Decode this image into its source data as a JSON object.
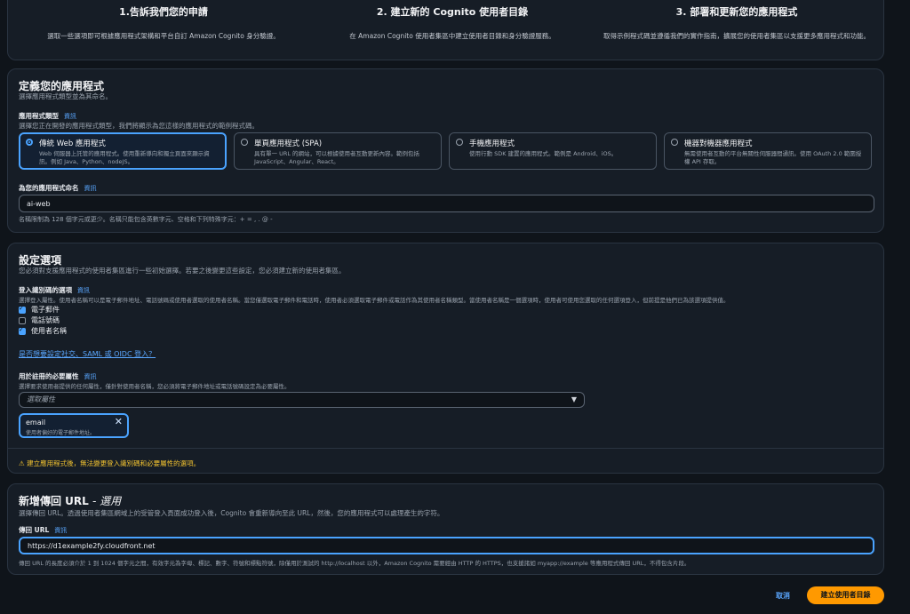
{
  "steps": [
    {
      "title": "1.告訴我們您的申請",
      "desc": "選取一些選項即可根據應用程式架構和平台自訂 Amazon Cognito 身分驗證。"
    },
    {
      "title": "2. 建立新的 Cognito 使用者目錄",
      "desc": "在 Amazon Cognito 使用者集區中建立使用者目錄和身分驗證服務。"
    },
    {
      "title": "3. 部署和更新您的應用程式",
      "desc": "取得示例程式碼並遵循我們的實作指南，擴展您的使用者集區以支援更多應用程式和功能。"
    }
  ],
  "define_app": {
    "title": "定義您的應用程式",
    "subtitle": "選擇應用程式類型並為其命名。",
    "type_label": "應用程式類型",
    "type_hint": "選擇您正在開發的應用程式類型，我們將顯示為您這樣的應用程式的範例程式碼。",
    "types": [
      {
        "title": "傳統 Web 應用程式",
        "desc": "Web 伺服器上託管的應用程式。使用重新導向和獨立頁面來顯示資訊。例如 Java、Python、nodeJS。"
      },
      {
        "title": "單頁應用程式 (SPA)",
        "desc": "具有單一 URL 的網站，可以根據使用者互動更新內容。範例包括 JavaScript、Angular、React。"
      },
      {
        "title": "手機應用程式",
        "desc": "使用行動 SDK 建置的應用程式。範例是 Android、iOS。"
      },
      {
        "title": "機器對機器應用程式",
        "desc": "無需使用者互動的平台無關性伺服器間通訊。使用 OAuth 2.0 範圍授權 API 存取。"
      }
    ],
    "name_label": "為您的應用程式命名",
    "name_value": "ai-web",
    "name_hint": "名稱限制為 128 個字元或更少。名稱只能包含英數字元、空格和下列特殊字元：+ = , . @ -"
  },
  "info": "資訊",
  "config": {
    "title": "設定選項",
    "subtitle": "您必須對支援應用程式的使用者集區進行一些初始選擇。若要之後變更這些設定，您必須建立新的使用者集區。",
    "signin_label": "登入識別碼的選項",
    "signin_hint": "選擇登入屬性。使用者名稱可以是電子郵件地址、電話號碼或使用者選取的使用者名稱。當您僅選取電子郵件和電話時，使用者必須選取電子郵件或電話作為其使用者名稱類型。當使用者名稱是一個選項時，使用者可使用您選取的任何選項登入，但前提是他們已為該選項提供值。",
    "options": [
      {
        "label": "電子郵件",
        "checked": true
      },
      {
        "label": "電話號碼",
        "checked": false
      },
      {
        "label": "使用者名稱",
        "checked": true
      }
    ],
    "social_link": "是否想要設定社交、SAML 或 OIDC 登入？",
    "required_label": "用於註冊的必要屬性",
    "required_hint": "選擇要求使用者提供的任何屬性，僅針對使用者名稱，您必須將電子郵件地址或電話號碼設定為必要屬性。",
    "select_placeholder": "選取屬性",
    "token_title": "email",
    "token_desc": "使用者偏好的電子郵件地址。",
    "warning": "建立應用程式後，無法變更登入識別碼和必要屬性的選項。"
  },
  "callback": {
    "title": "新增傳回 URL",
    "optional": "- 選用",
    "subtitle": "選擇傳回 URL。透過使用者集區網域上的受管登入頁面成功登入後，Cognito 會重新導向至此 URL，然後，您的應用程式可以處理產生的字符。",
    "url_label": "傳回 URL",
    "url_value": "https://d1example2fy.cloudfront.net",
    "url_hint": "傳回 URL 的長度必須介於 1 到 1024 個字元之間，有效字元為字母、標記、數字、符號和標點符號，除僅用於測試的 http://localhost 以外，Amazon Cognito 需要經由 HTTP 的 HTTPS，也支援諸如 myapp://example 等應用程式傳回 URL，不得包含片段。"
  },
  "footer": {
    "cancel": "取消",
    "submit": "建立使用者目錄"
  }
}
